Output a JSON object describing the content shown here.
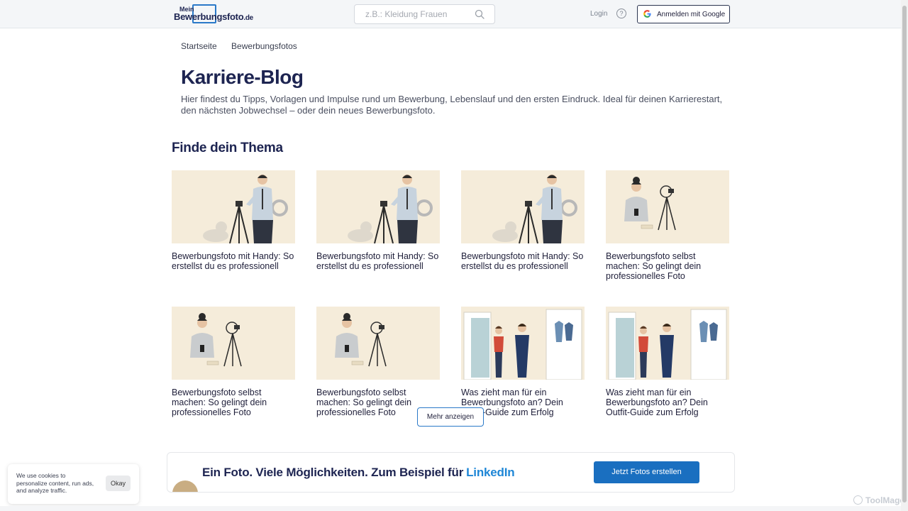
{
  "header": {
    "logo_small": "Mein",
    "logo_big": "Bewerbungsfoto",
    "logo_tld": ".de",
    "search_placeholder": "z.B.: Kleidung Frauen",
    "login": "Login",
    "google_button": "Anmelden mit Google"
  },
  "breadcrumb": [
    "Startseite",
    "Bewerbungsfotos"
  ],
  "page": {
    "title": "Karriere-Blog",
    "intro": "Hier findest du Tipps, Vorlagen und Impulse rund um Bewerbung, Lebenslauf und den ersten Eindruck. Ideal für deinen Karrierestart, den nächsten Jobwechsel – oder dein neues Bewerbungsfoto.",
    "section_title": "Finde dein Thema"
  },
  "cards": [
    {
      "title": "Bewerbungsfoto mit Handy: So erstellst du es professionell",
      "image": "man-phone-tripod-illustration"
    },
    {
      "title": "Bewerbungsfoto mit Handy: So erstellst du es professionell",
      "image": "man-phone-tripod-illustration"
    },
    {
      "title": "Bewerbungsfoto mit Handy: So erstellst du es professionell",
      "image": "man-phone-tripod-illustration"
    },
    {
      "title": "Bewerbungsfoto selbst machen: So gelingt dein professionelles Foto",
      "image": "woman-ringlight-illustration"
    },
    {
      "title": "Bewerbungsfoto selbst machen: So gelingt dein professionelles Foto",
      "image": "woman-ringlight-illustration"
    },
    {
      "title": "Bewerbungsfoto selbst machen: So gelingt dein professionelles Foto",
      "image": "woman-ringlight-illustration"
    },
    {
      "title": "Was zieht man für ein Bewerbungsfoto an? Dein Outfit-Guide zum Erfolg",
      "image": "couple-wardrobe-illustration"
    },
    {
      "title": "Was zieht man für ein Bewerbungsfoto an? Dein Outfit-Guide zum Erfolg",
      "image": "couple-wardrobe-illustration"
    }
  ],
  "more_button": "Mehr anzeigen",
  "promo": {
    "text": "Ein Foto. Viele Möglichkeiten. Zum Beispiel für",
    "highlight": "LinkedIn",
    "button": "Jetzt Fotos erstellen"
  },
  "cookie": {
    "text": "We use cookies to personalize content, run ads, and analyze traffic.",
    "button": "Okay"
  },
  "watermark": "ToolMage",
  "colors": {
    "brand_dark": "#1d2451",
    "accent_blue": "#1a6fc0",
    "highlight_blue": "#1e86d6",
    "card_background": "#f5ecda"
  }
}
